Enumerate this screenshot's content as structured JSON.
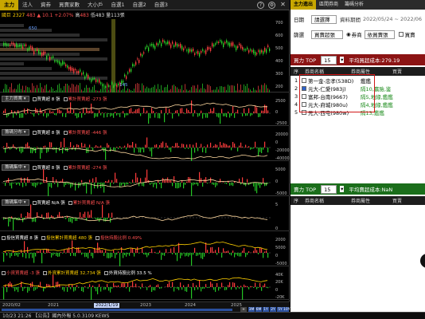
{
  "tabs": [
    "主力",
    "法人",
    "資券",
    "買賣家數",
    "大小戶",
    "自選1",
    "自選2",
    "自選3"
  ],
  "toolbar_icons": [
    "help-icon",
    "settings-icon",
    "close-icon"
  ],
  "quote": {
    "name": "國巨",
    "code": "2327",
    "price": "483",
    "change": "▲ 10.1",
    "change_pct": "+2.07%",
    "high_label": "高",
    "high": "483",
    "low_label": "低",
    "low": "483",
    "volume_label": "量",
    "volume": "113張"
  },
  "price_axis": [
    "700",
    "600",
    "500",
    "400",
    "300",
    "200"
  ],
  "price_marks": [
    "650",
    "145"
  ],
  "panes": [
    {
      "selector": "主力買賣",
      "legend": [
        {
          "label": "買賣超 8 張",
          "color": "#ffffff"
        },
        {
          "label": "累計買賣超 -273 張",
          "color": "#ff5050"
        }
      ],
      "axis": [
        "2500",
        "0",
        "-2500"
      ]
    },
    {
      "selector": "籌碼分布",
      "legend": [
        {
          "label": "買賣超 8 張",
          "color": "#ffffff"
        },
        {
          "label": "累計買賣超 -446 張",
          "color": "#ff5050"
        }
      ],
      "axis": [
        "20000",
        "0",
        "-20000",
        "-40000"
      ]
    },
    {
      "selector": "籌碼集中",
      "legend": [
        {
          "label": "買賣超 8 張",
          "color": "#ffffff"
        },
        {
          "label": "累計買賣超 -274 張",
          "color": "#ff5050"
        }
      ],
      "axis": [
        "5000",
        "0",
        "-5000"
      ]
    },
    {
      "selector": "籌碼集中",
      "legend": [
        {
          "label": "買賣超 N/A 張",
          "color": "#ffffff"
        },
        {
          "label": "累計買賣超 N/A 張",
          "color": "#ff5050"
        }
      ],
      "axis": [
        "5",
        "0"
      ]
    },
    {
      "selector": "",
      "legend": [
        {
          "label": "投信買賣超 8 張",
          "color": "#ffffff"
        },
        {
          "label": "投信累計買賣超 480 張",
          "color": "#ffd000"
        },
        {
          "label": "投信持股比例 0.49%",
          "color": "#ff5050"
        }
      ],
      "axis": [
        "2000",
        "5000",
        "0",
        "-5000"
      ]
    },
    {
      "selector": "",
      "legend": [
        {
          "label": "小資買賣超 -3 張",
          "color": "#ff5050"
        },
        {
          "label": "外資累計買賣超 32,734 張",
          "color": "#ffd000"
        },
        {
          "label": "外資持股比例 33.5 %",
          "color": "#ffffff"
        }
      ],
      "axis": [
        "40K",
        "20K",
        "0",
        "-20K"
      ]
    }
  ],
  "x_labels": [
    "2020/02",
    "2021",
    "2022/1/19",
    "2023",
    "2024",
    "2025"
  ],
  "timeframes": [
    "3M",
    "6M",
    "1Y",
    "2Y",
    "5Y",
    "10Y"
  ],
  "right_tabs": [
    "主力進出",
    "區間券商",
    "籌碼分析"
  ],
  "filter": {
    "date_label": "日期",
    "date_value": "請選擇",
    "range_label": "資料期間",
    "range_value": "2022/05/24 ~ 2022/06",
    "cat_label": "篩選",
    "cat_value": "買賣超張",
    "broker_label": "券商",
    "broker_value": "依買賣張",
    "check_label": "買賣"
  },
  "buy_section": {
    "title": "買力 TOP",
    "top_n": "15",
    "avg_cost": "平均買超成本:279.19",
    "bg": "#8c1414"
  },
  "sell_section": {
    "title": "賣力 TOP",
    "top_n": "15",
    "avg_cost": "平均賣超成本:NaN",
    "bg": "#1b6e1b"
  },
  "columns": [
    "序",
    "券商名稱",
    "券商屬性",
    "買賣"
  ],
  "rows": [
    {
      "num": "1",
      "checked": false,
      "name": "第一金-忠孝(538D)",
      "attr": "鑑鑑",
      "attr_color": "#000000"
    },
    {
      "num": "2",
      "checked": true,
      "name": "元大-仁愛(983j)",
      "attr": "隔10,贏險,鉴",
      "attr_color": "#1a8a1a"
    },
    {
      "num": "3",
      "checked": false,
      "name": "富邦-台南(9667)",
      "attr": "隔5,地緣,鑑鑑",
      "attr_color": "#1a8a1a"
    },
    {
      "num": "4",
      "checked": false,
      "name": "元大-府城(980u)",
      "attr": "隔4,地緣,鑑鑑",
      "attr_color": "#1a8a1a"
    },
    {
      "num": "5",
      "checked": false,
      "name": "元大-西屯(980w)",
      "attr": "隔13,鑑鑑",
      "attr_color": "#1a8a1a"
    }
  ],
  "status_text": "10/23 21:26   【公告】國內外報 5.0.3109 KEWS"
}
